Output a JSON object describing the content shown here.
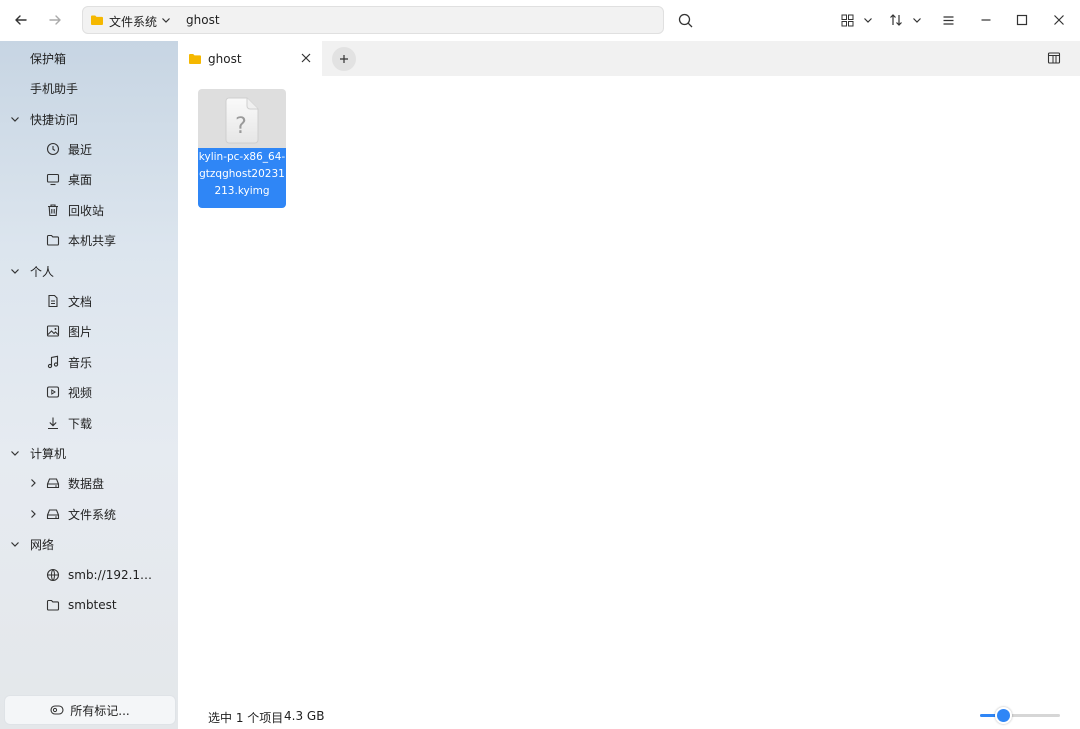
{
  "toolbar": {
    "back_icon": "arrow-left-icon",
    "forward_icon": "arrow-right-icon",
    "path": [
      "文件系统",
      "ghost"
    ],
    "search_icon": "search-icon",
    "view_icon": "grid-view-icon",
    "sort_icon": "sort-icon",
    "menu_icon": "hamburger-menu-icon",
    "minimize_icon": "minimize-icon",
    "maximize_icon": "maximize-icon",
    "close_icon": "close-icon"
  },
  "sidebar": {
    "items": [
      {
        "label": "保护箱",
        "level": 0
      },
      {
        "label": "手机助手",
        "level": 0
      },
      {
        "label": "快捷访问",
        "level": 0,
        "expanded": true
      },
      {
        "label": "最近",
        "level": 1,
        "icon": "clock-icon"
      },
      {
        "label": "桌面",
        "level": 1,
        "icon": "desktop-icon"
      },
      {
        "label": "回收站",
        "level": 1,
        "icon": "trash-icon"
      },
      {
        "label": "本机共享",
        "level": 1,
        "icon": "folder-icon"
      },
      {
        "label": "个人",
        "level": 0,
        "expanded": true
      },
      {
        "label": "文档",
        "level": 1,
        "icon": "document-icon"
      },
      {
        "label": "图片",
        "level": 1,
        "icon": "image-icon"
      },
      {
        "label": "音乐",
        "level": 1,
        "icon": "music-icon"
      },
      {
        "label": "视频",
        "level": 1,
        "icon": "video-icon"
      },
      {
        "label": "下载",
        "level": 1,
        "icon": "download-icon"
      },
      {
        "label": "计算机",
        "level": 0,
        "expanded": true
      },
      {
        "label": "数据盘",
        "level": 1,
        "icon": "drive-icon",
        "expandable": true
      },
      {
        "label": "文件系统",
        "level": 1,
        "icon": "drive-icon",
        "expandable": true
      },
      {
        "label": "网络",
        "level": 0,
        "expanded": true
      },
      {
        "label": "smb://192.1…",
        "level": 1,
        "icon": "network-icon"
      },
      {
        "label": "smbtest",
        "level": 1,
        "icon": "folder-icon"
      }
    ],
    "tags_button": "所有标记..."
  },
  "tabs": [
    {
      "label": "ghost",
      "active": true
    }
  ],
  "files": [
    {
      "name_lines": [
        "kylin-pc-x86_64-",
        "gtzqghost20231",
        "213.kyimg"
      ],
      "selected": true,
      "icon": "unknown-file-icon"
    }
  ],
  "status": {
    "selection": "选中 1 个项目",
    "size": "4.3 GB",
    "zoom_level": 0.3
  },
  "colors": {
    "accent": "#2f86f6",
    "folder": "#f5b800"
  }
}
